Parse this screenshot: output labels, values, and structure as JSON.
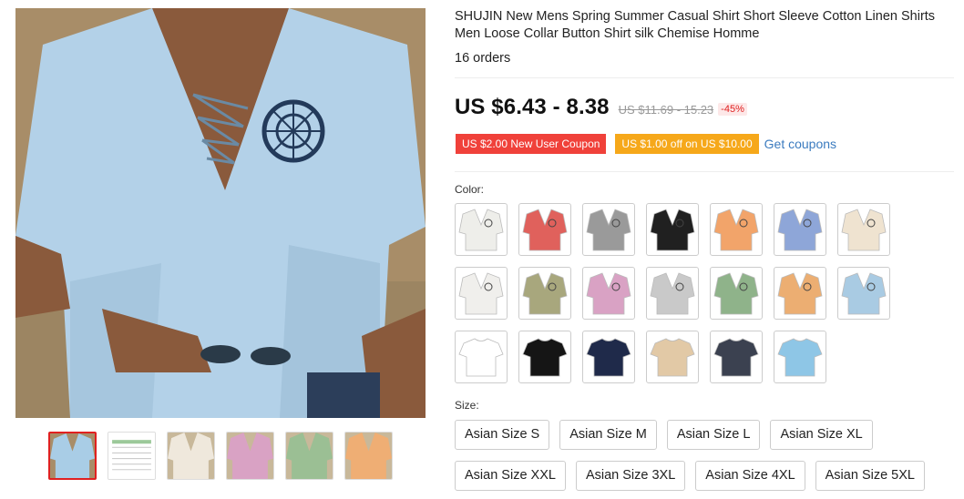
{
  "product": {
    "title": "SHUJIN New Mens Spring Summer Casual Shirt Short Sleeve Cotton Linen Shirts Men Loose Collar Button Shirt silk Chemise Homme",
    "orders": "16 orders",
    "price_now": "US $6.43 - 8.38",
    "price_old": "US $11.69 - 15.23",
    "discount": "-45%"
  },
  "coupons": {
    "new_user": "US $2.00 New User Coupon",
    "off": "US $1.00 off on US $10.00",
    "get_link": "Get coupons"
  },
  "color": {
    "label": "Color:",
    "swatches": [
      {
        "name": "white-print",
        "color": "#eeeeea"
      },
      {
        "name": "red-print",
        "color": "#e0615c"
      },
      {
        "name": "gray-print",
        "color": "#9a9a9a"
      },
      {
        "name": "black-print",
        "color": "#202020"
      },
      {
        "name": "orange-print",
        "color": "#f2a46a"
      },
      {
        "name": "blue-print",
        "color": "#8ea6d8"
      },
      {
        "name": "beige-print",
        "color": "#efe3d0"
      },
      {
        "name": "white-emblem",
        "color": "#f0efec"
      },
      {
        "name": "khaki-emblem",
        "color": "#a8a77d"
      },
      {
        "name": "pink-emblem",
        "color": "#d9a2c4"
      },
      {
        "name": "gray-emblem",
        "color": "#c9c9c9"
      },
      {
        "name": "green-emblem",
        "color": "#8fb38a"
      },
      {
        "name": "orange-emblem",
        "color": "#ecae72"
      },
      {
        "name": "lightblue-emblem",
        "color": "#a9cbe3"
      },
      {
        "name": "white-plain",
        "color": "#ffffff"
      },
      {
        "name": "black-plain",
        "color": "#151515"
      },
      {
        "name": "navy-plain",
        "color": "#1f2a4a"
      },
      {
        "name": "beige-plain",
        "color": "#e2c9a6"
      },
      {
        "name": "darkgray-plain",
        "color": "#3b4150"
      },
      {
        "name": "skyblue-plain",
        "color": "#8ec6e6"
      }
    ]
  },
  "size": {
    "label": "Size:",
    "row1": [
      "Asian Size S",
      "Asian Size M",
      "Asian Size L",
      "Asian Size XL"
    ],
    "row2": [
      "Asian Size XXL",
      "Asian Size 3XL",
      "Asian Size 4XL",
      "Asian Size 5XL"
    ]
  },
  "gallery": {
    "thumb_colors": [
      "#a9cde6",
      "#f4f4f4",
      "#efe8dc",
      "#d9a2c4",
      "#9bbf94",
      "#efae74"
    ]
  }
}
